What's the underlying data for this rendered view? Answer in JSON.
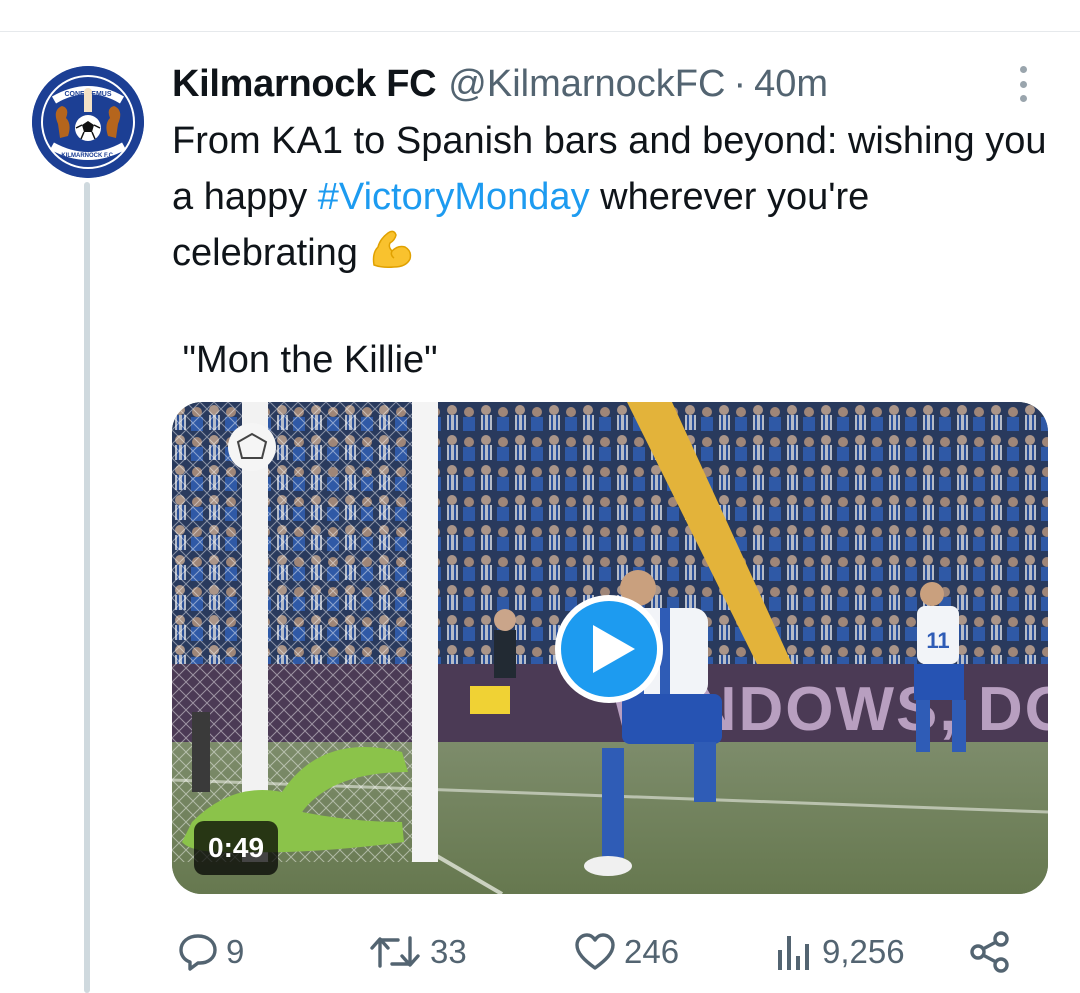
{
  "tweet": {
    "author": {
      "name": "Kilmarnock FC",
      "handle": "@KilmarnockFC",
      "separator": "·",
      "time": "40m",
      "avatar": {
        "badge_text_top": "CONFIDEMUS",
        "badge_text_bottom": "KILMARNOCK F.C."
      }
    },
    "text": {
      "part1": "From KA1 to Spanish bars and beyond: wishing you a happy ",
      "hashtag": "#VictoryMonday",
      "part2": " wherever you're celebrating ",
      "emoji": "flexed-biceps"
    },
    "quote": " \"Mon the Killie\"",
    "media": {
      "type": "video",
      "duration": "0:49",
      "stadium_sign": "WINDOWS, DOOR",
      "player_number": "11"
    },
    "actions": {
      "replies": "9",
      "retweets": "33",
      "likes": "246",
      "views": "9,256"
    }
  },
  "colors": {
    "link": "#1d9bf0",
    "secondary_text": "#536471",
    "thread_line": "#cfd9de",
    "badge_blue": "#1c3f94"
  }
}
